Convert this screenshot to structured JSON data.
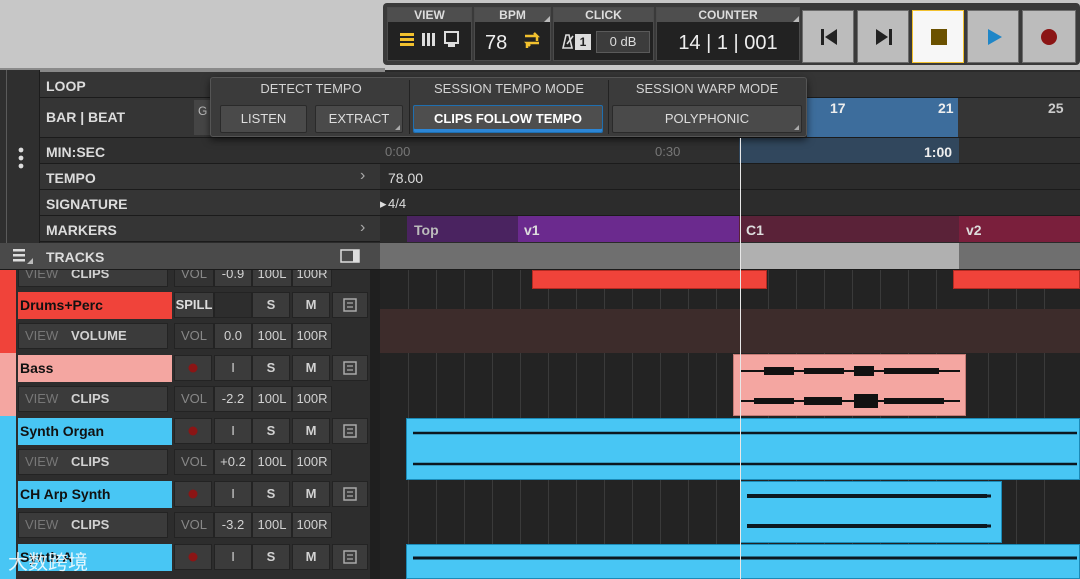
{
  "transport": {
    "view_label": "VIEW",
    "bpm_label": "BPM",
    "bpm_value": "78",
    "click_label": "CLICK",
    "click_number": "1",
    "click_level": "0 dB",
    "counter_label": "COUNTER",
    "counter_value": "14 | 1 | 001"
  },
  "popup": {
    "detect_tempo": "DETECT TEMPO",
    "session_tempo_mode": "SESSION TEMPO MODE",
    "session_warp_mode": "SESSION WARP MODE",
    "listen": "LISTEN",
    "extract": "EXTRACT",
    "clips_follow_tempo": "CLIPS FOLLOW TEMPO",
    "polyphonic": "POLYPHONIC"
  },
  "ruler": {
    "loop": "LOOP",
    "bar_beat": "BAR | BEAT",
    "bar_beat_cut": "G",
    "bars": [
      "17",
      "21",
      "25"
    ],
    "min_sec": "MIN:SEC",
    "times": [
      "0:00",
      "0:30",
      "1:00"
    ],
    "tempo": "TEMPO",
    "tempo_value": "78.00",
    "signature": "SIGNATURE",
    "signature_value": "4/4",
    "markers": "MARKERS",
    "marker_names": [
      "Top",
      "v1",
      "C1",
      "v2"
    ],
    "tracks": "TRACKS"
  },
  "tracks": [
    {
      "name": "",
      "mode": "VIEW",
      "kind": "CLIPS",
      "vol_label": "VOL",
      "vol": "-0.9",
      "pan_l": "100L",
      "pan_r": "100R"
    },
    {
      "name": "Drums+Perc",
      "spill": "SPILL",
      "s": "S",
      "m": "M",
      "mode": "VIEW",
      "kind": "VOLUME",
      "vol_label": "VOL",
      "vol": "0.0",
      "pan_l": "100L",
      "pan_r": "100R"
    },
    {
      "name": "Bass",
      "i": "I",
      "s": "S",
      "m": "M",
      "mode": "VIEW",
      "kind": "CLIPS",
      "vol_label": "VOL",
      "vol": "-2.2",
      "pan_l": "100L",
      "pan_r": "100R"
    },
    {
      "name": "Synth Organ",
      "i": "I",
      "s": "S",
      "m": "M",
      "mode": "VIEW",
      "kind": "CLIPS",
      "vol_label": "VOL",
      "vol": "+0.2",
      "pan_l": "100L",
      "pan_r": "100R"
    },
    {
      "name": "CH Arp Synth",
      "i": "I",
      "s": "S",
      "m": "M",
      "mode": "VIEW",
      "kind": "CLIPS",
      "vol_label": "VOL",
      "vol": "-3.2",
      "pan_l": "100L",
      "pan_r": "100R"
    },
    {
      "name": "Synth A",
      "i": "I",
      "s": "S",
      "m": "M"
    }
  ],
  "watermark": "大数跨境",
  "colors": {
    "red": "#f0433a",
    "salmon": "#f4a6a1",
    "cyan": "#48c6f4",
    "purple": "#6b2a8e",
    "crimson": "#7a1f3c",
    "stop": "#6b5100",
    "play": "#1f86c7",
    "record": "#8b1515",
    "yellow": "#f2c12e"
  }
}
